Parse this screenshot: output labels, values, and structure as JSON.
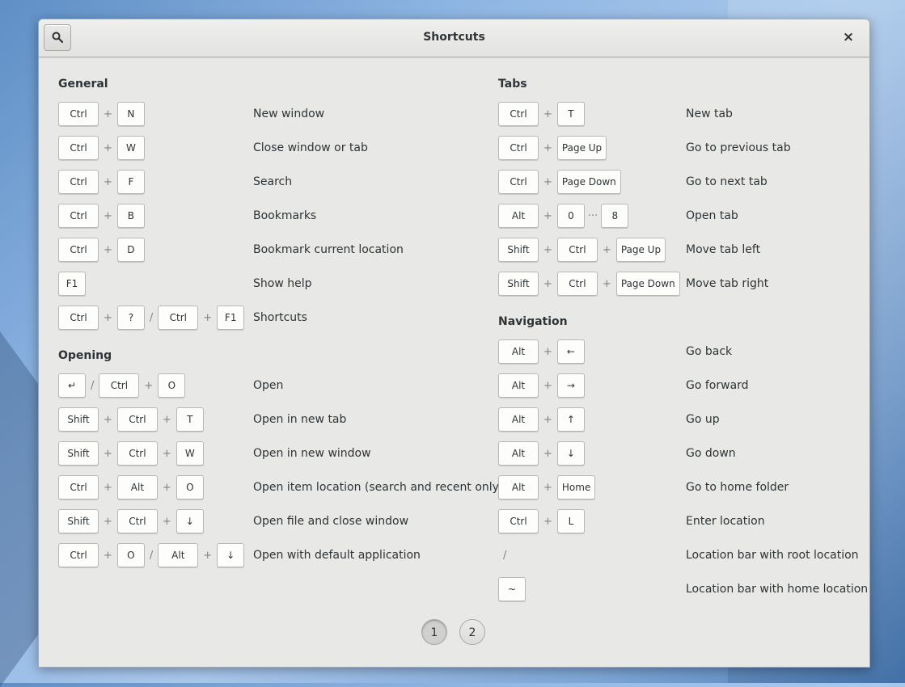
{
  "window": {
    "title": "Shortcuts",
    "search_icon": "search-icon",
    "close_glyph": "×"
  },
  "left": {
    "general": {
      "title": "General",
      "rows": [
        {
          "keys": [
            "Ctrl",
            "+",
            "N"
          ],
          "desc": "New window"
        },
        {
          "keys": [
            "Ctrl",
            "+",
            "W"
          ],
          "desc": "Close window or tab"
        },
        {
          "keys": [
            "Ctrl",
            "+",
            "F"
          ],
          "desc": "Search"
        },
        {
          "keys": [
            "Ctrl",
            "+",
            "B"
          ],
          "desc": "Bookmarks"
        },
        {
          "keys": [
            "Ctrl",
            "+",
            "D"
          ],
          "desc": "Bookmark current location"
        },
        {
          "keys": [
            "F1"
          ],
          "desc": "Show help"
        },
        {
          "keys": [
            "Ctrl",
            "+",
            "?",
            "/",
            "Ctrl",
            "+",
            "F1"
          ],
          "desc": "Shortcuts"
        }
      ]
    },
    "opening": {
      "title": "Opening",
      "rows": [
        {
          "keys": [
            "↵",
            "/",
            "Ctrl",
            "+",
            "O"
          ],
          "desc": "Open"
        },
        {
          "keys": [
            "Shift",
            "+",
            "Ctrl",
            "+",
            "T"
          ],
          "desc": "Open in new tab"
        },
        {
          "keys": [
            "Shift",
            "+",
            "Ctrl",
            "+",
            "W"
          ],
          "desc": "Open in new window"
        },
        {
          "keys": [
            "Ctrl",
            "+",
            "Alt",
            "+",
            "O"
          ],
          "desc": "Open item location (search and recent only)"
        },
        {
          "keys": [
            "Shift",
            "+",
            "Ctrl",
            "+",
            "↓"
          ],
          "desc": "Open file and close window"
        },
        {
          "keys": [
            "Ctrl",
            "+",
            "O",
            "/",
            "Alt",
            "+",
            "↓"
          ],
          "desc": "Open with default application"
        }
      ]
    }
  },
  "right": {
    "tabs": {
      "title": "Tabs",
      "rows": [
        {
          "keys": [
            "Ctrl",
            "+",
            "T"
          ],
          "desc": "New tab"
        },
        {
          "keys": [
            "Ctrl",
            "+",
            "Page Up"
          ],
          "desc": "Go to previous tab"
        },
        {
          "keys": [
            "Ctrl",
            "+",
            "Page Down"
          ],
          "desc": "Go to next tab"
        },
        {
          "keys": [
            "Alt",
            "+",
            "0",
            "···",
            "8"
          ],
          "desc": "Open tab"
        },
        {
          "keys": [
            "Shift",
            "+",
            "Ctrl",
            "+",
            "Page Up"
          ],
          "desc": "Move tab left"
        },
        {
          "keys": [
            "Shift",
            "+",
            "Ctrl",
            "+",
            "Page Down"
          ],
          "desc": "Move tab right"
        }
      ]
    },
    "navigation": {
      "title": "Navigation",
      "rows": [
        {
          "keys": [
            "Alt",
            "+",
            "←"
          ],
          "desc": "Go back"
        },
        {
          "keys": [
            "Alt",
            "+",
            "→"
          ],
          "desc": "Go forward"
        },
        {
          "keys": [
            "Alt",
            "+",
            "↑"
          ],
          "desc": "Go up"
        },
        {
          "keys": [
            "Alt",
            "+",
            "↓"
          ],
          "desc": "Go down"
        },
        {
          "keys": [
            "Alt",
            "+",
            "Home"
          ],
          "desc": "Go to home folder"
        },
        {
          "keys": [
            "Ctrl",
            "+",
            "L"
          ],
          "desc": "Enter location"
        },
        {
          "keys": [
            "/"
          ],
          "desc": "Location bar with root location"
        },
        {
          "keys": [
            "~"
          ],
          "desc": "Location bar with home location"
        }
      ]
    }
  },
  "pages": [
    "1",
    "2"
  ],
  "active_page": "1"
}
